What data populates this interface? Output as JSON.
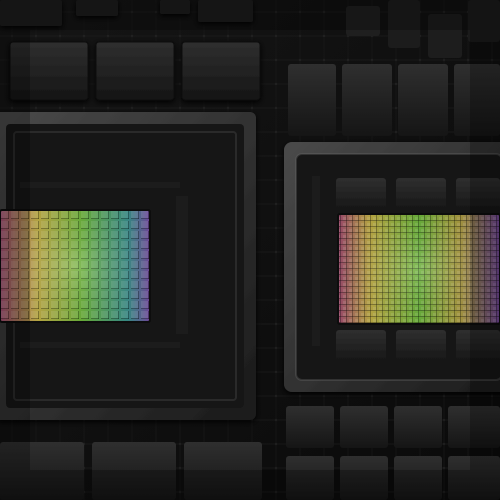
{
  "scene": {
    "description_visible_text": "",
    "palette": {
      "board": "#111111",
      "chip_dark": "#1c1c1c",
      "chip_mid": "#2b2b2b",
      "package_frame": "#3a3a3a",
      "die_green": "#6fbf3a",
      "die_yellow": "#d6c24a",
      "die_purple": "#7a4aa8",
      "die_pink": "#b0507a",
      "die_teal": "#3fa6a0"
    },
    "components": {
      "left_processor": {
        "label": ""
      },
      "right_processor": {
        "label": ""
      }
    }
  }
}
